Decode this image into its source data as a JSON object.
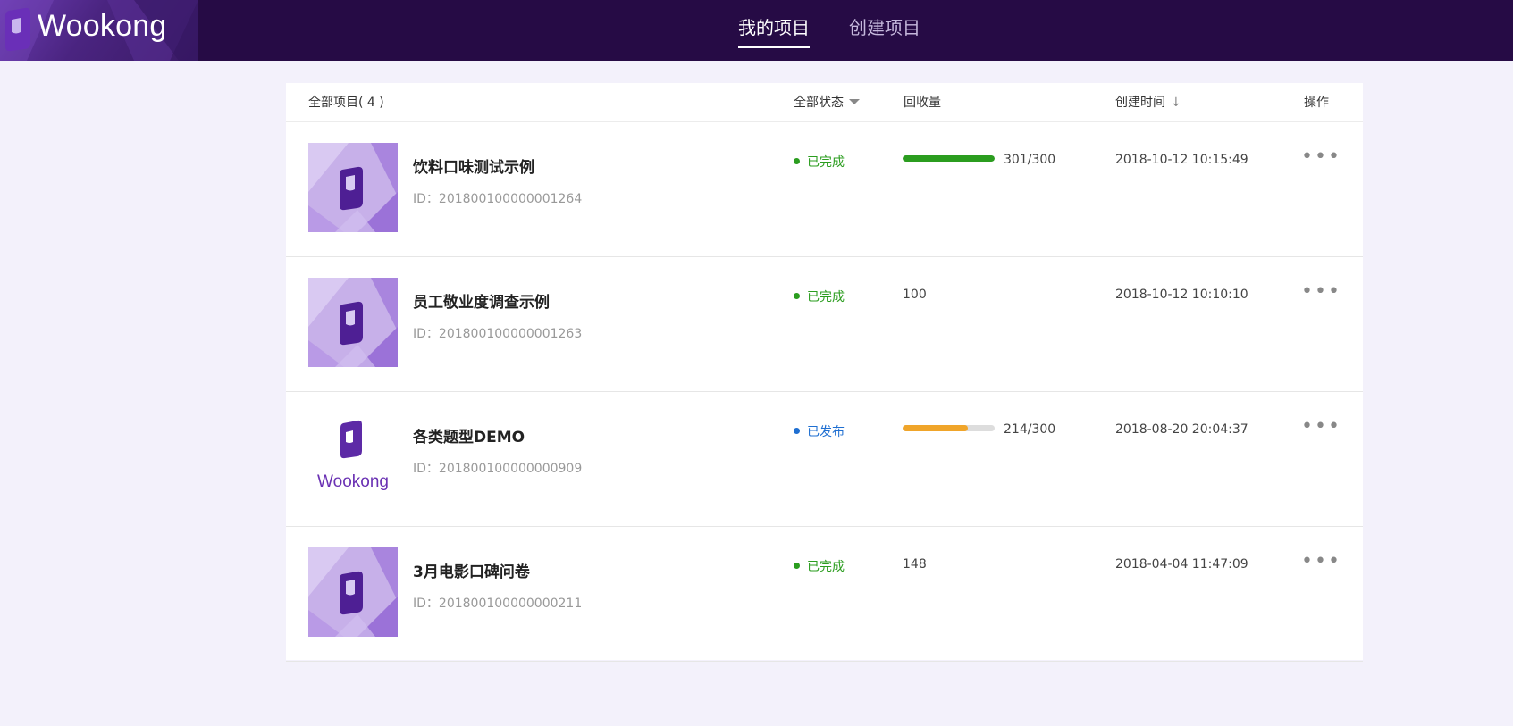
{
  "header": {
    "brand": "Wookong",
    "nav": [
      {
        "label": "我的项目",
        "active": true
      },
      {
        "label": "创建项目",
        "active": false
      }
    ]
  },
  "colors": {
    "topbar": "#260b45",
    "completed": "#2b9d1f",
    "published": "#1f6fd1",
    "bar_green": "#2b9d1f",
    "bar_orange": "#f0a52a",
    "bar_track": "#dddddd"
  },
  "table": {
    "headers": {
      "name": "全部项目( 4 )",
      "status": "全部状态",
      "count": "回收量",
      "time": "创建时间",
      "ops": "操作"
    },
    "rows": [
      {
        "title": "饮料口味测试示例",
        "id": "ID：201800100000001264",
        "status": "已完成",
        "status_color": "completed",
        "count": "301/300",
        "progress": 1.0,
        "bar_color": "bar_green",
        "has_bar": true,
        "time": "2018-10-12 10:15:49",
        "thumb": "purple"
      },
      {
        "title": "员工敬业度调查示例",
        "id": "ID：201800100000001263",
        "status": "已完成",
        "status_color": "completed",
        "count": "100",
        "progress": null,
        "has_bar": false,
        "time": "2018-10-12 10:10:10",
        "thumb": "purple"
      },
      {
        "title": "各类题型DEMO",
        "id": "ID：201800100000000909",
        "status": "已发布",
        "status_color": "published",
        "count": "214/300",
        "progress": 0.713,
        "bar_color": "bar_orange",
        "has_bar": true,
        "time": "2018-08-20 20:04:37",
        "thumb": "logo",
        "thumb_text": "Wookong"
      },
      {
        "title": "3月电影口碑问卷",
        "id": "ID：201800100000000211",
        "status": "已完成",
        "status_color": "completed",
        "count": "148",
        "progress": null,
        "has_bar": false,
        "time": "2018-04-04 11:47:09",
        "thumb": "purple"
      }
    ],
    "ops_label": "•••"
  }
}
